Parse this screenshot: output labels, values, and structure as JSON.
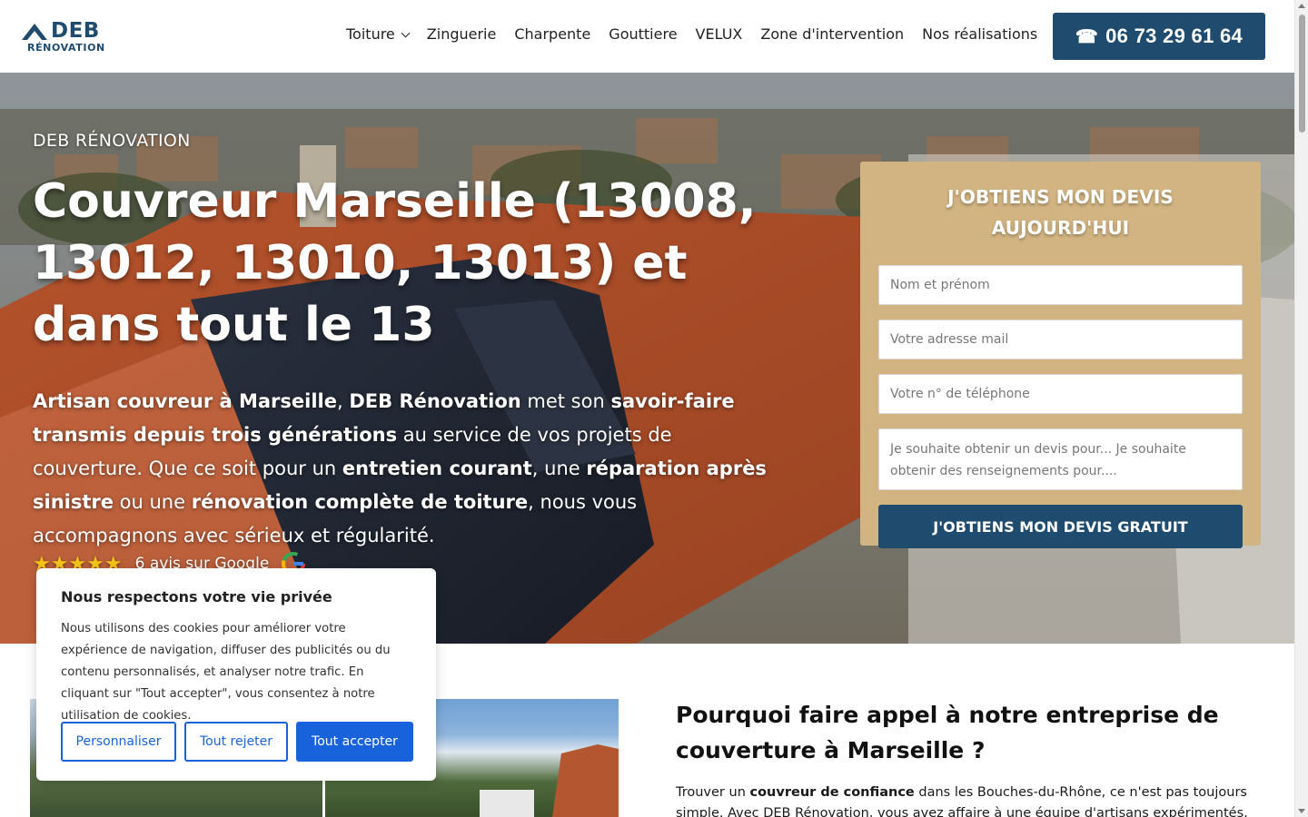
{
  "header": {
    "logo_main": "DEB",
    "logo_sub": "RÉNOVATION",
    "nav": [
      {
        "label": "Toiture",
        "has_dropdown": true
      },
      {
        "label": "Zinguerie"
      },
      {
        "label": "Charpente"
      },
      {
        "label": "Gouttiere"
      },
      {
        "label": "VELUX"
      },
      {
        "label": "Zone d'intervention"
      },
      {
        "label": "Nos réalisations"
      }
    ],
    "phone_icon": "☎",
    "phone": "06 73 29 61 64"
  },
  "hero": {
    "kicker": "DEB RÉNOVATION",
    "title": "Couvreur Marseille (13008, 13012, 13010, 13013) et dans tout le 13",
    "text": {
      "p1_bold": "Artisan couvreur à Marseille",
      "p2": ", ",
      "p3_bold": "DEB Rénovation",
      "p4": " met son ",
      "p5_bold": "savoir-faire transmis depuis trois générations",
      "p6": " au service de vos projets de couverture. Que ce soit pour un ",
      "p7_bold": "entretien courant",
      "p8": ", une ",
      "p9_bold": "réparation après sinistre",
      "p10": " ou une ",
      "p11_bold": "rénovation complète de toiture",
      "p12": ", nous vous accompagnons avec sérieux et régularité."
    },
    "rating": {
      "stars": "★★★★★",
      "label": "6 avis sur Google"
    }
  },
  "form": {
    "title": "J'OBTIENS MON DEVIS AUJOURD'HUI",
    "name_placeholder": "Nom et prénom",
    "email_placeholder": "Votre adresse mail",
    "phone_placeholder": "Votre n° de téléphone",
    "message_placeholder": "Je souhaite obtenir un devis pour... Je souhaite obtenir des renseignements pour....",
    "submit_label": "J'OBTIENS MON DEVIS GRATUIT"
  },
  "section": {
    "title": "Pourquoi faire appel à notre entreprise de couverture à Marseille ?",
    "text_a": "Trouver un ",
    "text_b_bold": "couvreur de confiance",
    "text_c": " dans les Bouches-du-Rhône, ce n'est pas toujours simple. Avec DEB Rénovation, vous avez affaire à une équipe d'artisans expérimentés, capables de"
  },
  "cookie": {
    "title": "Nous respectons votre vie privée",
    "text": "Nous utilisons des cookies pour améliorer votre expérience de navigation, diffuser des publicités ou du contenu personnalisés, et analyser notre trafic. En cliquant sur \"Tout accepter\", vous consentez à notre utilisation de cookies.",
    "customize": "Personnaliser",
    "reject": "Tout rejeter",
    "accept": "Tout accepter"
  },
  "colors": {
    "brand_blue": "#1e4b6e",
    "form_tan": "#d2b482",
    "cookie_blue": "#1863dc",
    "star_gold": "#f5c518"
  }
}
